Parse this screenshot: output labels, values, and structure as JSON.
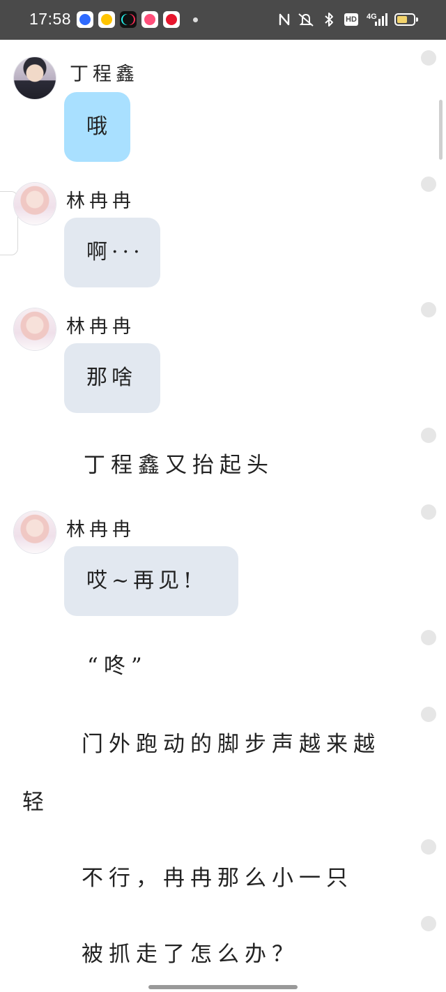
{
  "status_bar": {
    "time": "17:58",
    "network": "4G",
    "hd": "HD",
    "app_icons": [
      "baidu-app-icon",
      "smile-app-icon",
      "tiktok-app-icon",
      "bubble-app-icon",
      "weibo-app-icon"
    ],
    "system_icons": [
      "nfc-icon",
      "mute-icon",
      "bluetooth-icon",
      "hd-icon",
      "signal-icon",
      "battery-icon"
    ],
    "colors": {
      "background": "#4a4a4a",
      "battery_fill": "#f2d36b"
    }
  },
  "messages": [
    {
      "sender": "丁程鑫",
      "text": "哦",
      "style": "blue"
    },
    {
      "sender": "林冉冉",
      "text": "啊···",
      "style": "grey"
    },
    {
      "sender": "林冉冉",
      "text": "那啥",
      "style": "grey"
    },
    {
      "sender": "林冉冉",
      "text": "哎~再见!",
      "style": "grey"
    }
  ],
  "narration": [
    "丁程鑫又抬起头",
    "“咚”",
    "门外跑动的脚步声越来越",
    "轻",
    "不行，冉冉那么小一只",
    "被抓走了怎么办？"
  ],
  "colors": {
    "bubble_blue": "#a9e0ff",
    "bubble_grey": "#e2e8f0",
    "page_background": "#ffffff"
  }
}
